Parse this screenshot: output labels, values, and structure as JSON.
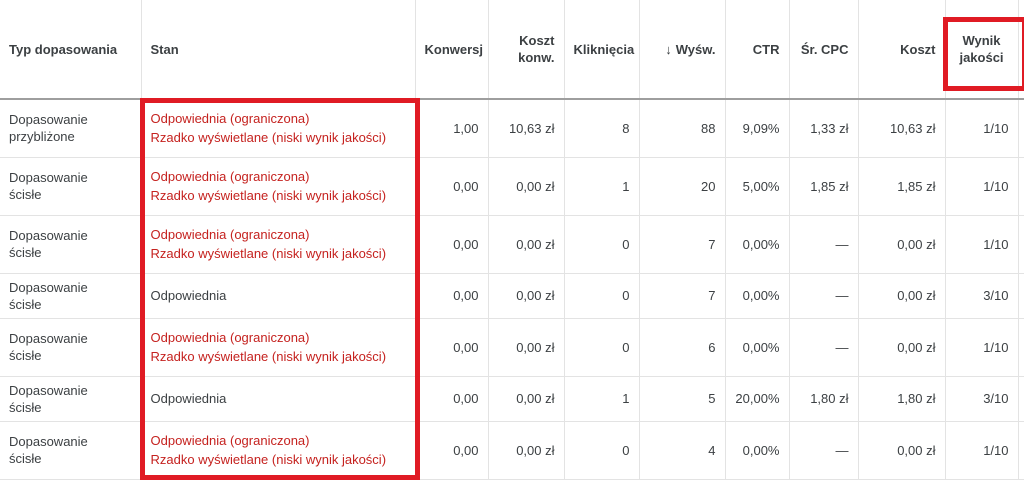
{
  "headers": {
    "typ": "Typ dopasowania",
    "stan": "Stan",
    "konwersje": "Konwersj",
    "koszt_konw_1": "Koszt",
    "koszt_konw_2": "konw.",
    "klikniecia": "Kliknięcia",
    "wysw_arrow": "↓",
    "wysw": "Wyśw.",
    "ctr": "CTR",
    "sr_cpc": "Śr. CPC",
    "koszt": "Koszt",
    "wynik_1": "Wynik",
    "wynik_2": "jakości"
  },
  "rows": [
    {
      "typ_1": "Dopasowanie",
      "typ_2": "przybliżone",
      "stan_1": "Odpowiednia (ograniczona)",
      "stan_2": "Rzadko wyświetlane (niski wynik jakości)",
      "konw": "1,00",
      "koszt_konw": "10,63 zł",
      "klik": "8",
      "wysw": "88",
      "ctr": "9,09%",
      "cpc": "1,33 zł",
      "koszt": "10,63 zł",
      "wynik": "1/10"
    },
    {
      "typ_1": "Dopasowanie",
      "typ_2": "ścisłe",
      "stan_1": "Odpowiednia (ograniczona)",
      "stan_2": "Rzadko wyświetlane (niski wynik jakości)",
      "konw": "0,00",
      "koszt_konw": "0,00 zł",
      "klik": "1",
      "wysw": "20",
      "ctr": "5,00%",
      "cpc": "1,85 zł",
      "koszt": "1,85 zł",
      "wynik": "1/10"
    },
    {
      "typ_1": "Dopasowanie",
      "typ_2": "ścisłe",
      "stan_1": "Odpowiednia (ograniczona)",
      "stan_2": "Rzadko wyświetlane (niski wynik jakości)",
      "konw": "0,00",
      "koszt_konw": "0,00 zł",
      "klik": "0",
      "wysw": "7",
      "ctr": "0,00%",
      "cpc": "—",
      "koszt": "0,00 zł",
      "wynik": "1/10"
    },
    {
      "typ_1": "Dopasowanie",
      "typ_2": "ścisłe",
      "stan_1": "Odpowiednia",
      "stan_2": "",
      "konw": "0,00",
      "koszt_konw": "0,00 zł",
      "klik": "0",
      "wysw": "7",
      "ctr": "0,00%",
      "cpc": "—",
      "koszt": "0,00 zł",
      "wynik": "3/10"
    },
    {
      "typ_1": "Dopasowanie",
      "typ_2": "ścisłe",
      "stan_1": "Odpowiednia (ograniczona)",
      "stan_2": "Rzadko wyświetlane (niski wynik jakości)",
      "konw": "0,00",
      "koszt_konw": "0,00 zł",
      "klik": "0",
      "wysw": "6",
      "ctr": "0,00%",
      "cpc": "—",
      "koszt": "0,00 zł",
      "wynik": "1/10"
    },
    {
      "typ_1": "Dopasowanie",
      "typ_2": "ścisłe",
      "stan_1": "Odpowiednia",
      "stan_2": "",
      "konw": "0,00",
      "koszt_konw": "0,00 zł",
      "klik": "1",
      "wysw": "5",
      "ctr": "20,00%",
      "cpc": "1,80 zł",
      "koszt": "1,80 zł",
      "wynik": "3/10"
    },
    {
      "typ_1": "Dopasowanie",
      "typ_2": "ścisłe",
      "stan_1": "Odpowiednia (ograniczona)",
      "stan_2": "Rzadko wyświetlane (niski wynik jakości)",
      "konw": "0,00",
      "koszt_konw": "0,00 zł",
      "klik": "0",
      "wysw": "4",
      "ctr": "0,00%",
      "cpc": "—",
      "koszt": "0,00 zł",
      "wynik": "1/10"
    }
  ],
  "colors": {
    "status_warning": "#c5221f",
    "highlight_box": "#e01b24",
    "text": "#3c4043"
  }
}
